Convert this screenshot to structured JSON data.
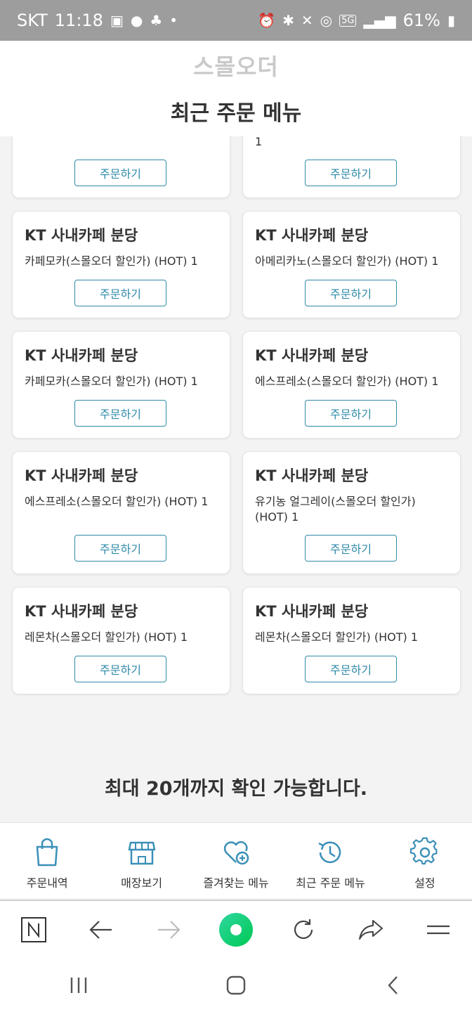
{
  "status_bar": {
    "carrier": "SKT",
    "time": "11:18",
    "network": "5G",
    "battery": "61%"
  },
  "header": {
    "logo": "스몰오더",
    "title": "최근 주문 메뉴"
  },
  "orders": [
    {
      "store": "",
      "item": "",
      "button": "주문하기"
    },
    {
      "store": "",
      "item": "1",
      "button": "주문하기"
    },
    {
      "store": "KT 사내카페 분당",
      "item": "카페모카(스몰오더 할인가) (HOT) 1",
      "button": "주문하기"
    },
    {
      "store": "KT 사내카페 분당",
      "item": "아메리카노(스몰오더 할인가) (HOT) 1",
      "button": "주문하기"
    },
    {
      "store": "KT 사내카페 분당",
      "item": "카페모카(스몰오더 할인가) (HOT) 1",
      "button": "주문하기"
    },
    {
      "store": "KT 사내카페 분당",
      "item": "에스프레소(스몰오더 할인가) (HOT) 1",
      "button": "주문하기"
    },
    {
      "store": "KT 사내카페 분당",
      "item": "에스프레소(스몰오더 할인가) (HOT) 1",
      "button": "주문하기"
    },
    {
      "store": "KT 사내카페 분당",
      "item": "유기농 얼그레이(스몰오더 할인가) (HOT) 1",
      "button": "주문하기"
    },
    {
      "store": "KT 사내카페 분당",
      "item": "레몬차(스몰오더 할인가) (HOT) 1",
      "button": "주문하기"
    },
    {
      "store": "KT 사내카페 분당",
      "item": "레몬차(스몰오더 할인가) (HOT) 1",
      "button": "주문하기"
    }
  ],
  "footer_note": "최대 20개까지 확인 가능합니다.",
  "tabs": [
    {
      "label": "주문내역",
      "icon": "shopping-bag-icon"
    },
    {
      "label": "매장보기",
      "icon": "store-icon"
    },
    {
      "label": "즐겨찾는 메뉴",
      "icon": "heart-plus-icon"
    },
    {
      "label": "최근 주문 메뉴",
      "icon": "history-icon"
    },
    {
      "label": "설정",
      "icon": "gear-icon"
    }
  ],
  "colors": {
    "accent": "#2f8aa8",
    "icon": "#3a8fb8",
    "status_bar": "#9d9d9d"
  }
}
